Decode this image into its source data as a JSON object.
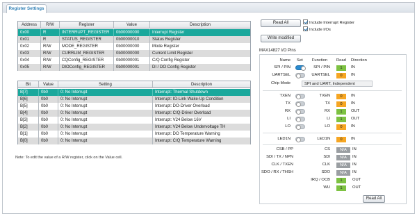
{
  "tab": {
    "label": "Register Settings"
  },
  "register_table": {
    "headers": [
      "Address",
      "R/W",
      "Register",
      "Value",
      "Description"
    ],
    "rows": [
      [
        "0x00",
        "R",
        "INTERRUPT_REGISTER",
        "0b00000000",
        "Interrupt Register"
      ],
      [
        "0x01",
        "R",
        "STATUS_REGISTER",
        "0b00000010",
        "Status Register"
      ],
      [
        "0x02",
        "R/W",
        "MODE_REGISTER",
        "0b00000000",
        "Mode Register"
      ],
      [
        "0x03",
        "R/W",
        "CURRLIM_REGISTER",
        "0b00000000",
        "Current Limit Register"
      ],
      [
        "0x04",
        "R/W",
        "CQConfig_REGISTER",
        "0b00000001",
        "C/Q Config Register"
      ],
      [
        "0x05",
        "R/W",
        "DIOConfig_REGISTER",
        "0b00000001",
        "DI / DO Config Register"
      ]
    ]
  },
  "bit_table": {
    "headers": [
      "Bit",
      "Value",
      "Setting",
      "Description"
    ],
    "rows": [
      [
        "B[7]",
        "0b0",
        "0: No Interrupt",
        "Interrupt: Thermal Shutdown"
      ],
      [
        "B[6]",
        "0b0",
        "0: No Interrupt",
        "Interrupt: IO-Link Wake-Up Condition"
      ],
      [
        "B[5]",
        "0b0",
        "0: No Interrupt",
        "Interrupt: DO-Driver Overload"
      ],
      [
        "B[4]",
        "0b0",
        "0: No Interrupt",
        "Interrupt: C/Q-Driver Overload"
      ],
      [
        "B[3]",
        "0b0",
        "0: No Interrupt",
        "Interrupt: V24 Below 16V"
      ],
      [
        "B[2]",
        "0b0",
        "0: No Interrupt",
        "Interrupt: V24 Below Undervoltage TH"
      ],
      [
        "B[1]",
        "0b0",
        "0: No Interrupt",
        "Interrupt: DO Temperature Warning"
      ],
      [
        "B[0]",
        "0b0",
        "0: No Interrupt",
        "Interrupt: C/Q Temperature Warning"
      ]
    ]
  },
  "note": "Note: To edit the value of a R/W register, click on the Value cell.",
  "controls": {
    "read_all": "Read All",
    "write_modified": "Write modified",
    "include_interrupt": "Include Interrupt Register",
    "include_ios": "Include I/Os"
  },
  "pins": {
    "title": "MAX14827 I/O Pins",
    "headers": {
      "name": "Name",
      "set": "Set",
      "function": "Function",
      "read": "Read",
      "direction": "Direction"
    },
    "spi_pin": {
      "name": "SPI / PIN",
      "set": "on",
      "function": "SPI / PIN",
      "read": "1",
      "read_color": "green",
      "direction": "IN"
    },
    "uartsel": {
      "name": "UARTSEL",
      "set": "off",
      "function": "UARTSEL",
      "read": "0",
      "read_color": "orange",
      "direction": "IN"
    },
    "chip_mode_label": "Chip Mode",
    "chip_mode_value": "SPI and UART, Independent",
    "io_rows": [
      {
        "name": "TXEN",
        "function": "TXEN",
        "read": "0",
        "read_color": "orange",
        "direction": "IN"
      },
      {
        "name": "TX",
        "function": "TX",
        "read": "0",
        "read_color": "orange",
        "direction": "IN"
      },
      {
        "name": "RX",
        "function": "RX",
        "read": "1",
        "read_color": "green",
        "direction": "OUT"
      },
      {
        "name": "LI",
        "function": "LI",
        "read": "1",
        "read_color": "green",
        "direction": "OUT"
      },
      {
        "name": "LO",
        "function": "LO",
        "read": "0",
        "read_color": "orange",
        "direction": "IN"
      }
    ],
    "led_row": {
      "name": "LED1N",
      "function": "LED1N",
      "read": "0",
      "read_color": "orange",
      "direction": "IN"
    },
    "other_rows": [
      {
        "name": "CSB / PP",
        "function": "CS",
        "read": "N/A",
        "direction": "IN"
      },
      {
        "name": "SDI / TX / NPN",
        "function": "SDI",
        "read": "N/A",
        "direction": "IN"
      },
      {
        "name": "CLK / TXEN",
        "function": "CLK",
        "read": "N/A",
        "direction": "IN"
      },
      {
        "name": "SDO / RX / THSH",
        "function": "SDO",
        "read": "N/A",
        "direction": "IN"
      },
      {
        "name": "",
        "function": "IRQ / OCB",
        "read": "1",
        "read_color": "green",
        "direction": "OUT"
      },
      {
        "name": "",
        "function": "WU",
        "read": "1",
        "read_color": "green",
        "direction": "OUT"
      }
    ],
    "read_all": "Read All"
  }
}
